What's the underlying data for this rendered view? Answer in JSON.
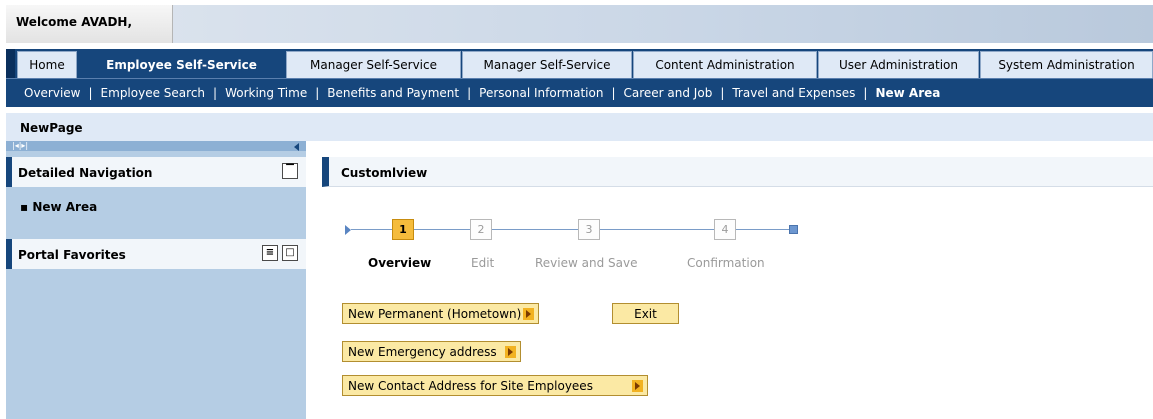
{
  "header": {
    "welcome": "Welcome AVADH,"
  },
  "top_nav": [
    {
      "label": "Home",
      "selected": false
    },
    {
      "label": "Employee Self-Service",
      "selected": true
    },
    {
      "label": "Manager Self-Service",
      "selected": false
    },
    {
      "label": "Manager Self-Service",
      "selected": false
    },
    {
      "label": "Content Administration",
      "selected": false
    },
    {
      "label": "User Administration",
      "selected": false
    },
    {
      "label": "System Administration",
      "selected": false
    }
  ],
  "sub_nav": [
    {
      "label": "Overview"
    },
    {
      "label": "Employee Search"
    },
    {
      "label": "Working Time"
    },
    {
      "label": "Benefits and Payment"
    },
    {
      "label": "Personal Information"
    },
    {
      "label": "Career and Job"
    },
    {
      "label": "Travel and Expenses"
    },
    {
      "label": "New Area",
      "active": true
    }
  ],
  "page_title": "NewPage",
  "left_panel": {
    "pager_text": "|◂|▸|",
    "detailed_navigation": {
      "title": "Detailed Navigation",
      "items": [
        "New Area"
      ]
    },
    "portal_favorites": {
      "title": "Portal Favorites"
    }
  },
  "main": {
    "header": "Customlview",
    "roadmap": [
      {
        "number": "1",
        "label": "Overview",
        "active": true
      },
      {
        "number": "2",
        "label": "Edit",
        "active": false
      },
      {
        "number": "3",
        "label": "Review and Save",
        "active": false
      },
      {
        "number": "4",
        "label": "Confirmation",
        "active": false
      }
    ],
    "buttons": {
      "new_permanent": "New Permanent (Hometown)",
      "exit": "Exit",
      "new_emergency": "New Emergency address",
      "new_contact": "New Contact Address for Site Employees"
    }
  },
  "colors": {
    "nav_blue": "#16467c",
    "active_step": "#f5bc3c",
    "button_fill": "#fbe9a4",
    "panel_blue": "#b5cde4"
  }
}
